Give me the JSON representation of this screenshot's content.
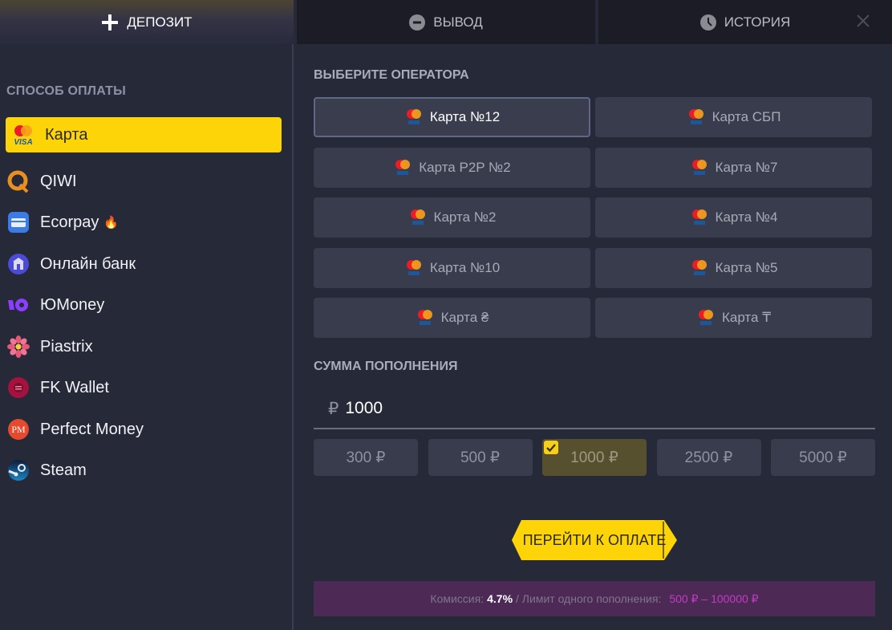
{
  "tabs": [
    {
      "label": "Депозит",
      "icon": "plus-icon",
      "active": true
    },
    {
      "label": "Вывод",
      "icon": "minus-circle-icon",
      "active": false
    },
    {
      "label": "История",
      "icon": "clock-icon",
      "active": false
    }
  ],
  "close_icon": "close-icon",
  "sidebar": {
    "title": "Способ оплаты",
    "items": [
      {
        "label": "Карта",
        "icon": "card-visa-mastercard-icon",
        "selected": true
      },
      {
        "label": "QIWI",
        "icon": "qiwi-icon"
      },
      {
        "label": "Ecorpay",
        "icon": "ecorpay-card-icon",
        "badge": "🔥"
      },
      {
        "label": "Онлайн банк",
        "icon": "bank-icon"
      },
      {
        "label": "ЮMoney",
        "icon": "yoomoney-icon"
      },
      {
        "label": "Piastrix",
        "icon": "piastrix-flower-icon"
      },
      {
        "label": "FK Wallet",
        "icon": "fk-wallet-icon"
      },
      {
        "label": "Perfect Money",
        "icon": "perfect-money-icon",
        "icon_text": "PM"
      },
      {
        "label": "Steam",
        "icon": "steam-icon"
      }
    ]
  },
  "operators": {
    "title": "Выберите оператора",
    "items": [
      {
        "label": "Карта №12",
        "selected": true
      },
      {
        "label": "Карта СБП"
      },
      {
        "label": "Карта P2P №2"
      },
      {
        "label": "Карта №7"
      },
      {
        "label": "Карта №2"
      },
      {
        "label": "Карта №4"
      },
      {
        "label": "Карта №10"
      },
      {
        "label": "Карта №5"
      },
      {
        "label": "Карта ₴"
      },
      {
        "label": "Карта ₸"
      }
    ]
  },
  "amount": {
    "title": "Сумма пополнения",
    "currency_symbol": "₽",
    "value": "1000",
    "presets": [
      {
        "label": "300 ₽"
      },
      {
        "label": "500 ₽"
      },
      {
        "label": "1000 ₽",
        "selected": true
      },
      {
        "label": "2500 ₽"
      },
      {
        "label": "5000 ₽"
      }
    ]
  },
  "pay_button": {
    "label": "ПЕРЕЙТИ К ОПЛАТЕ"
  },
  "info": {
    "commission_label": "Комиссия:",
    "commission_value": "4.7%",
    "limit_label": "/ Лимит одного пополнения:",
    "limit_value": "500 ₽ – 100000 ₽"
  },
  "colors": {
    "accent_yellow": "#fdd407",
    "background": "#262938",
    "button_bg": "#393c4c",
    "info_bg": "#4d2a56",
    "limit_magenta": "#c13bc4"
  }
}
